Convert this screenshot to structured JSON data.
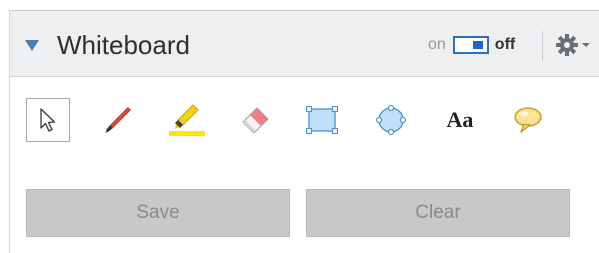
{
  "panel": {
    "title": "Whiteboard",
    "toggle": {
      "on_label": "on",
      "off_label": "off",
      "state": "off"
    }
  },
  "tools": [
    {
      "name": "select",
      "icon": "cursor-icon",
      "selected": true
    },
    {
      "name": "pen",
      "icon": "pen-icon"
    },
    {
      "name": "highlighter",
      "icon": "highlighter-icon"
    },
    {
      "name": "eraser",
      "icon": "eraser-icon"
    },
    {
      "name": "rectangle",
      "icon": "rectangle-icon"
    },
    {
      "name": "circle",
      "icon": "circle-icon"
    },
    {
      "name": "text",
      "icon": "text-icon",
      "label": "Aa"
    },
    {
      "name": "speech-bubble",
      "icon": "speech-bubble-icon"
    }
  ],
  "buttons": {
    "save_label": "Save",
    "clear_label": "Clear"
  },
  "colors": {
    "accent": "#1e68c9",
    "header_bg": "#eeeff1",
    "button_bg": "#c8c8c8"
  }
}
